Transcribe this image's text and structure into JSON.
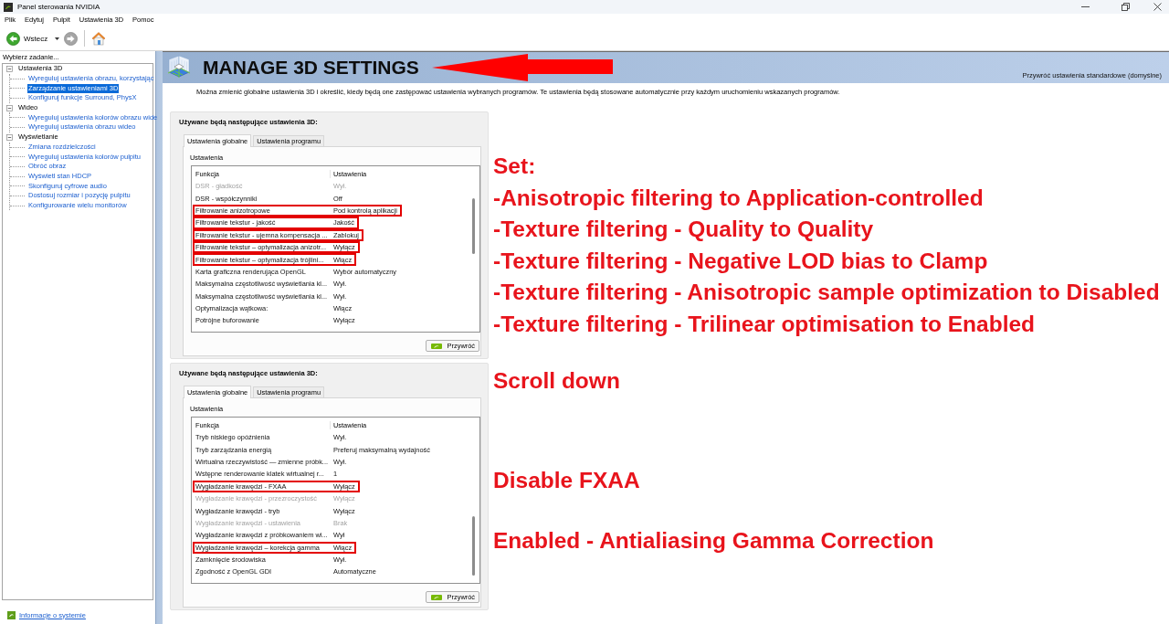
{
  "window": {
    "title": "Panel sterowania NVIDIA"
  },
  "menu": [
    "Plik",
    "Edytuj",
    "Pulpit",
    "Ustawienia 3D",
    "Pomoc"
  ],
  "toolbar": {
    "back_label": "Wstecz"
  },
  "sidebar": {
    "heading": "Wybierz zadanie...",
    "tree": [
      {
        "label": "Ustawienia 3D",
        "expanded": true,
        "selected": false,
        "children": [
          {
            "label": "Wyreguluj ustawienia obrazu, korzystając",
            "selected": false
          },
          {
            "label": "Zarządzanie ustawieniami 3D",
            "selected": true
          },
          {
            "label": "Konfiguruj funkcje Surround, PhysX",
            "selected": false
          }
        ]
      },
      {
        "label": "Wideo",
        "expanded": true,
        "selected": false,
        "children": [
          {
            "label": "Wyreguluj ustawienia kolorów obrazu wide",
            "selected": false
          },
          {
            "label": "Wyreguluj ustawienia obrazu wideo",
            "selected": false
          }
        ]
      },
      {
        "label": "Wyświetlanie",
        "expanded": true,
        "selected": false,
        "children": [
          {
            "label": "Zmiana rozdzielczości",
            "selected": false
          },
          {
            "label": "Wyreguluj ustawienia kolorów pulpitu",
            "selected": false
          },
          {
            "label": "Obróć obraz",
            "selected": false
          },
          {
            "label": "Wyświetl stan HDCP",
            "selected": false
          },
          {
            "label": "Skonfiguruj cyfrowe audio",
            "selected": false
          },
          {
            "label": "Dostosuj rozmiar i pozycję pulpitu",
            "selected": false
          },
          {
            "label": "Konfigurowanie wielu monitorów",
            "selected": false
          }
        ]
      }
    ],
    "footer_link": "Informacje o systemie"
  },
  "page": {
    "title": "MANAGE 3D SETTINGS",
    "restore_defaults_link": "Przywróć ustawienia standardowe (domyślne)",
    "description": "Można zmienić globalne ustawienia 3D i określić, kiedy będą one zastępować ustawienia wybranych programów. Te ustawienia będą stosowane automatycznie przy każdym uruchomieniu wskazanych programów."
  },
  "panels": [
    {
      "heading": "Używane będą następujące ustawienia 3D:",
      "tabs": [
        {
          "label": "Ustawienia globalne",
          "selected": true
        },
        {
          "label": "Ustawienia programu",
          "selected": false
        }
      ],
      "group_label": "Ustawienia",
      "columns": [
        "Funkcja",
        "Ustawienia"
      ],
      "rows": [
        {
          "feature": "DSR - gładkość",
          "setting": "Wył.",
          "disabled": true,
          "highlighted": false
        },
        {
          "feature": "DSR - współczynniki",
          "setting": "Off",
          "disabled": false,
          "highlighted": false
        },
        {
          "feature": "Filtrowanie anizotropowe",
          "setting": "Pod kontrolą aplikacji",
          "disabled": false,
          "highlighted": true
        },
        {
          "feature": "Filtrowanie tekstur - jakość",
          "setting": "Jakość",
          "disabled": false,
          "highlighted": true
        },
        {
          "feature": "Filtrowanie tekstur - ujemna kompensacja ...",
          "setting": "Zablokuj",
          "disabled": false,
          "highlighted": true
        },
        {
          "feature": "Filtrowanie tekstur – optymalizacja anizotr...",
          "setting": "Wyłącz",
          "disabled": false,
          "highlighted": true
        },
        {
          "feature": "Filtrowanie tekstur – optymalizacja trójlini...",
          "setting": "Włącz",
          "disabled": false,
          "highlighted": true
        },
        {
          "feature": "Karta graficzna renderująca OpenGL",
          "setting": "Wybór automatyczny",
          "disabled": false,
          "highlighted": false
        },
        {
          "feature": "Maksymalna częstotliwość wyświetlania kl...",
          "setting": "Wył.",
          "disabled": false,
          "highlighted": false
        },
        {
          "feature": "Maksymalna częstotliwość wyświetlania kl...",
          "setting": "Wył.",
          "disabled": false,
          "highlighted": false
        },
        {
          "feature": "Optymalizacja wątkowa:",
          "setting": "Włącz",
          "disabled": false,
          "highlighted": false
        },
        {
          "feature": "Potrójne buforowanie",
          "setting": "Wyłącz",
          "disabled": false,
          "highlighted": false
        }
      ],
      "button": "Przywróć"
    },
    {
      "heading": "Używane będą następujące ustawienia 3D:",
      "tabs": [
        {
          "label": "Ustawienia globalne",
          "selected": true
        },
        {
          "label": "Ustawienia programu",
          "selected": false
        }
      ],
      "group_label": "Ustawienia",
      "columns": [
        "Funkcja",
        "Ustawienia"
      ],
      "rows": [
        {
          "feature": "Tryb niskiego opóźnienia",
          "setting": "Wył.",
          "disabled": false,
          "highlighted": false
        },
        {
          "feature": "Tryb zarządzania energią",
          "setting": "Preferuj maksymalną wydajność",
          "disabled": false,
          "highlighted": false
        },
        {
          "feature": "Wirtualna rzeczywistość — zmienne próbk...",
          "setting": "Wył.",
          "disabled": false,
          "highlighted": false
        },
        {
          "feature": "Wstępne renderowanie klatek wirtualnej r...",
          "setting": "1",
          "disabled": false,
          "highlighted": false
        },
        {
          "feature": "Wygładzanie krawędzi - FXAA",
          "setting": "Wyłącz",
          "disabled": false,
          "highlighted": true
        },
        {
          "feature": "Wygładzanie krawędzi - przezroczystość",
          "setting": "Wyłącz",
          "disabled": true,
          "highlighted": false
        },
        {
          "feature": "Wygładzanie krawędzi - tryb",
          "setting": "Wyłącz",
          "disabled": false,
          "highlighted": false
        },
        {
          "feature": "Wygładzanie krawędzi - ustawienia",
          "setting": "Brak",
          "disabled": true,
          "highlighted": false
        },
        {
          "feature": "Wygładzanie krawędzi z próbkowaniem wi...",
          "setting": "Wył",
          "disabled": false,
          "highlighted": false
        },
        {
          "feature": "Wygładzanie krawędzi – korekcja gamma",
          "setting": "Włącz",
          "disabled": false,
          "highlighted": true
        },
        {
          "feature": "Zamknięcie środowiska",
          "setting": "Wył.",
          "disabled": false,
          "highlighted": false
        },
        {
          "feature": "Zgodność z OpenGL GDI",
          "setting": "Automatyczne",
          "disabled": false,
          "highlighted": false
        }
      ],
      "button": "Przywróć"
    }
  ],
  "annotations": [
    {
      "lines": [
        "Set:",
        "-Anisotropic filtering to Application-controlled",
        "-Texture filtering - Quality to Quality",
        "-Texture filtering - Negative LOD bias to Clamp",
        "-Texture filtering - Anisotropic sample optimization to Disabled",
        "-Texture filtering - Trilinear optimisation to Enabled"
      ]
    },
    {
      "lines": [
        "Scroll down"
      ]
    },
    {
      "lines": [
        "Disable FXAA"
      ]
    },
    {
      "lines": [
        "Enabled - Antialiasing Gamma Correction"
      ]
    }
  ]
}
